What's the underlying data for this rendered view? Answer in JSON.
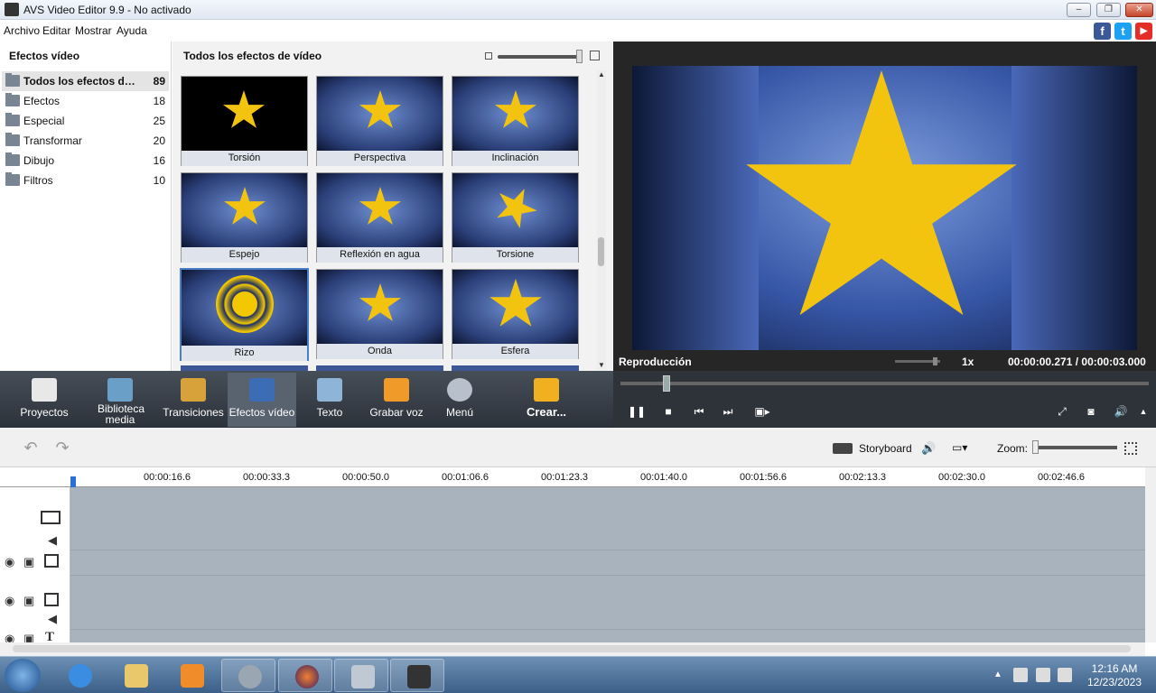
{
  "window": {
    "title": "AVS Video Editor 9.9 - No activado"
  },
  "menu": [
    "Archivo",
    "Editar",
    "Mostrar",
    "Ayuda"
  ],
  "social": [
    {
      "name": "facebook",
      "glyph": "f",
      "color": "#3b5998"
    },
    {
      "name": "twitter",
      "glyph": "t",
      "color": "#1da1f2"
    },
    {
      "name": "youtube",
      "glyph": "▶",
      "color": "#e52d27"
    }
  ],
  "left_panel": {
    "title": "Efectos vídeo",
    "categories": [
      {
        "label": "Todos los efectos de...",
        "count": "89",
        "selected": true
      },
      {
        "label": "Efectos",
        "count": "18"
      },
      {
        "label": "Especial",
        "count": "25"
      },
      {
        "label": "Transformar",
        "count": "20"
      },
      {
        "label": "Dibujo",
        "count": "16"
      },
      {
        "label": "Filtros",
        "count": "10"
      }
    ]
  },
  "center": {
    "title": "Todos los efectos de vídeo",
    "effects": [
      {
        "label": "Torsión"
      },
      {
        "label": "Perspectiva"
      },
      {
        "label": "Inclinación"
      },
      {
        "label": "Espejo"
      },
      {
        "label": "Reflexión en agua"
      },
      {
        "label": "Torsione"
      },
      {
        "label": "Rizo",
        "selected": true
      },
      {
        "label": "Onda"
      },
      {
        "label": "Esfera"
      }
    ]
  },
  "preview": {
    "label": "Reproducción",
    "speed": "1x",
    "time_current": "00:00:00.271",
    "time_sep": " / ",
    "time_total": "00:00:03.000"
  },
  "toolbar": [
    {
      "label": "Proyectos",
      "icon": "clapper-icon",
      "color": "#e8e8e8"
    },
    {
      "label": "Biblioteca media",
      "icon": "film-library-icon",
      "color": "#6aa0c8"
    },
    {
      "label": "Transiciones",
      "icon": "transitions-icon",
      "color": "#d8a23a"
    },
    {
      "label": "Efectos vídeo",
      "icon": "star-effects-icon",
      "color": "#3c6cb4",
      "active": true
    },
    {
      "label": "Texto",
      "icon": "text-icon",
      "color": "#8eb4d8"
    },
    {
      "label": "Grabar voz",
      "icon": "microphone-icon",
      "color": "#f09a2a"
    },
    {
      "label": "Menú",
      "icon": "disc-menu-icon",
      "color": "#b8c0cc"
    },
    {
      "label": "Crear...",
      "icon": "create-film-icon",
      "color": "#f0b020"
    }
  ],
  "timeline": {
    "storyboard_label": "Storyboard",
    "zoom_label": "Zoom:",
    "ticks": [
      "00:00:16.6",
      "00:00:33.3",
      "00:00:50.0",
      "00:01:06.6",
      "00:01:23.3",
      "00:01:40.0",
      "00:01:56.6",
      "00:02:13.3",
      "00:02:30.0",
      "00:02:46.6"
    ]
  },
  "taskbar": {
    "time": "12:16 AM",
    "date": "12/23/2023"
  }
}
